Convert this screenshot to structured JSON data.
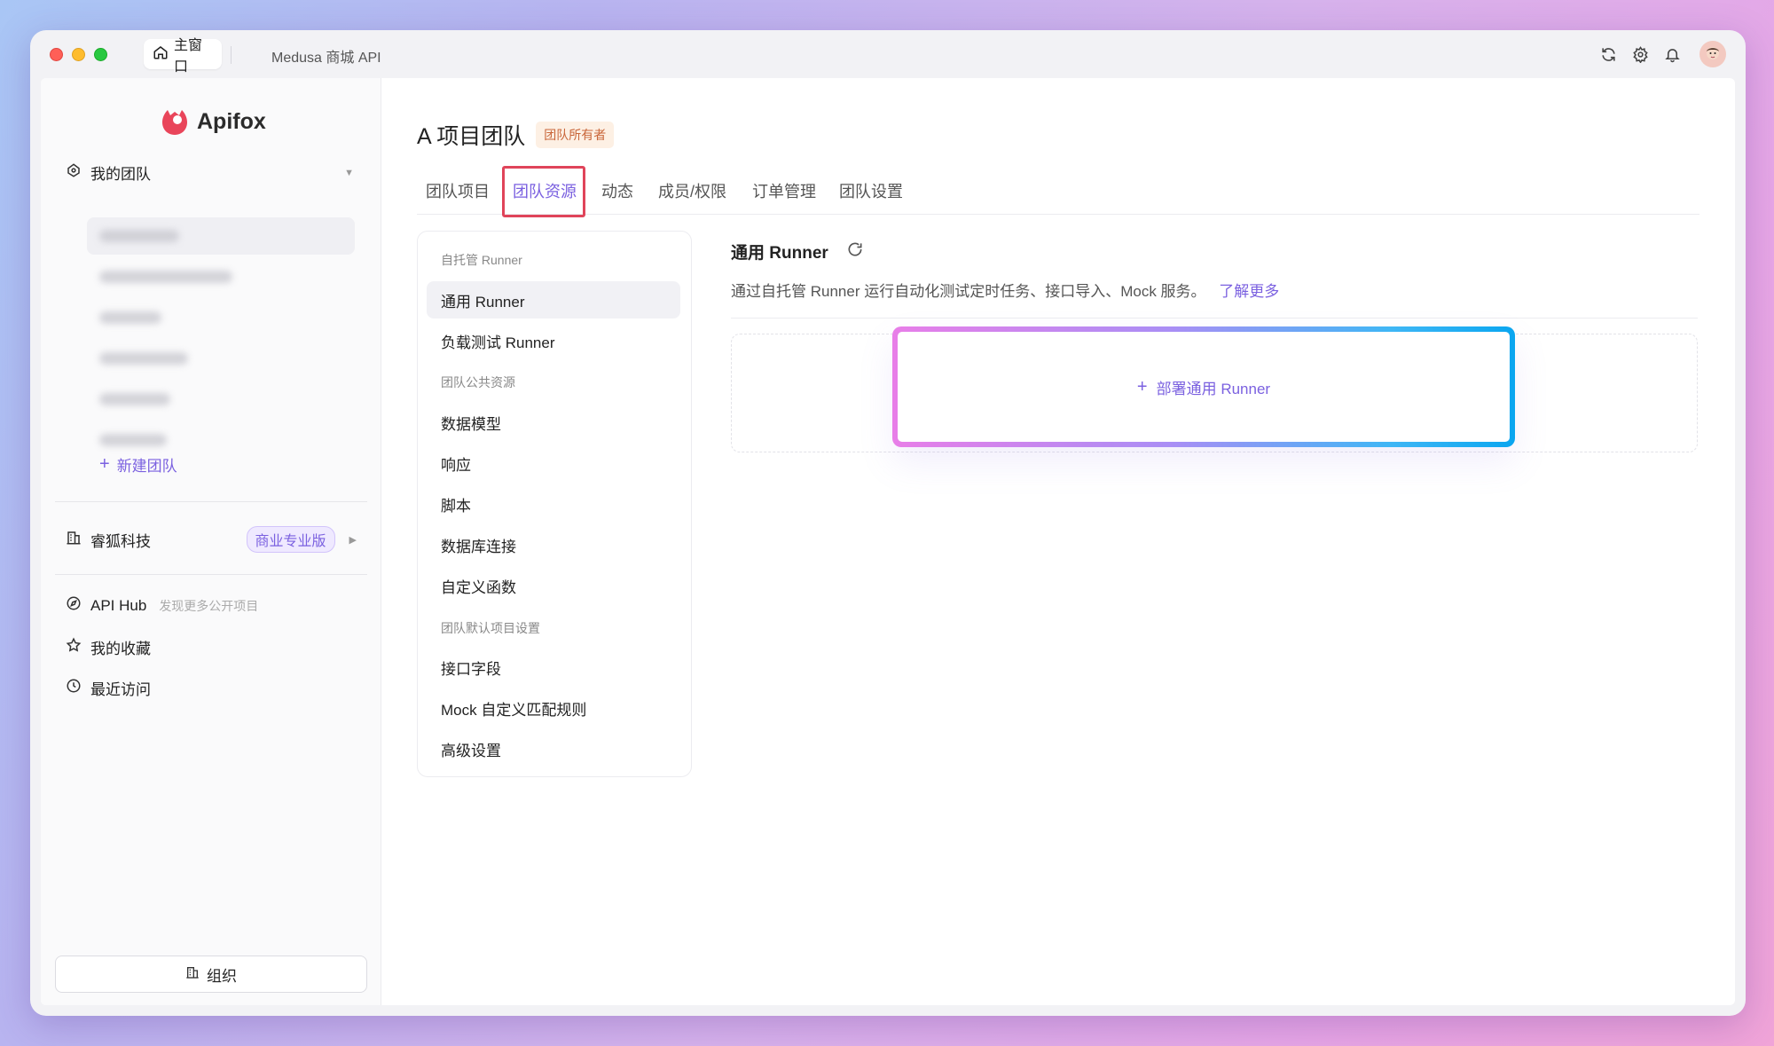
{
  "titlebar": {
    "home_tab_label": "主窗口",
    "project_tab_label": "Medusa 商城 API"
  },
  "sidebar": {
    "brand": "Apifox",
    "my_teams_label": "我的团队",
    "new_team_label": "新建团队",
    "org_name": "睿狐科技",
    "org_plan_badge": "商业专业版",
    "api_hub_label": "API Hub",
    "api_hub_sub": "发现更多公开项目",
    "favorites_label": "我的收藏",
    "recent_label": "最近访问",
    "org_button_label": "组织"
  },
  "main": {
    "team_title": "A 项目团队",
    "owner_badge": "团队所有者",
    "tabs": [
      {
        "label": "团队项目"
      },
      {
        "label": "团队资源"
      },
      {
        "label": "动态"
      },
      {
        "label": "成员/权限"
      },
      {
        "label": "订单管理"
      },
      {
        "label": "团队设置"
      }
    ],
    "active_tab": "团队资源"
  },
  "subnav": {
    "groups": [
      {
        "title": "自托管 Runner",
        "items": [
          "通用 Runner",
          "负载测试 Runner"
        ]
      },
      {
        "title": "团队公共资源",
        "items": [
          "数据模型",
          "响应",
          "脚本",
          "数据库连接",
          "自定义函数"
        ]
      },
      {
        "title": "团队默认项目设置",
        "items": [
          "接口字段",
          "Mock 自定义匹配规则",
          "高级设置"
        ]
      }
    ],
    "active_item": "通用 Runner"
  },
  "panel": {
    "title": "通用 Runner",
    "description": "通过自托管 Runner 运行自动化测试定时任务、接口导入、Mock 服务。",
    "learn_more": "了解更多",
    "deploy_button": "部署通用 Runner"
  },
  "colors": {
    "accent": "#7b61e0",
    "highlight_border": "#e0445a",
    "owner_badge_text": "#c9663a"
  }
}
